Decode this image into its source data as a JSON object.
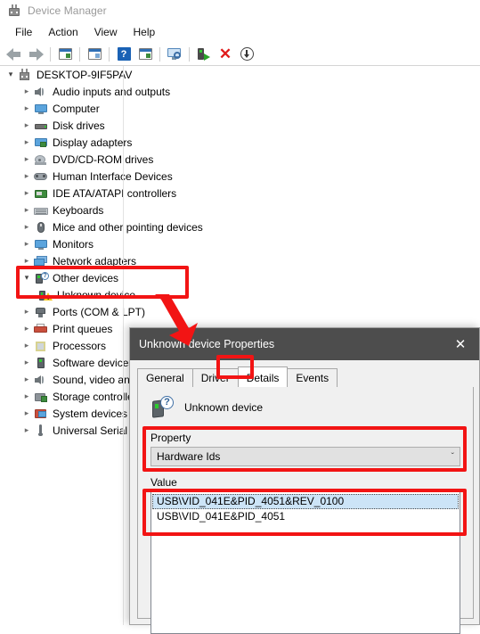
{
  "window": {
    "title": "Device Manager",
    "icon": "device-manager-icon"
  },
  "menubar": {
    "items": [
      {
        "label": "File"
      },
      {
        "label": "Action"
      },
      {
        "label": "View"
      },
      {
        "label": "Help"
      }
    ]
  },
  "toolbar": {
    "buttons": [
      {
        "name": "back-button",
        "icon": "back-arrow-icon"
      },
      {
        "name": "forward-button",
        "icon": "forward-arrow-icon"
      },
      {
        "name": "show-hide-console-tree-button",
        "icon": "console-tree-icon"
      },
      {
        "name": "properties-button",
        "icon": "properties-window-icon"
      },
      {
        "name": "help-button",
        "icon": "help-question-icon"
      },
      {
        "name": "show-hide-action-pane-button",
        "icon": "action-pane-icon"
      },
      {
        "name": "scan-for-hardware-changes-button",
        "icon": "monitor-magnifier-icon"
      },
      {
        "name": "update-driver-button",
        "icon": "device-update-icon"
      },
      {
        "name": "uninstall-device-button",
        "icon": "red-x-icon"
      },
      {
        "name": "disable-device-button",
        "icon": "down-arrow-circle-icon"
      }
    ]
  },
  "tree": {
    "root": {
      "label": "DESKTOP-9IF5PAV",
      "icon": "computer-icon",
      "expanded": true
    },
    "items": [
      {
        "label": "Audio inputs and outputs",
        "icon": "speaker-icon",
        "expanded": false
      },
      {
        "label": "Computer",
        "icon": "monitor-icon",
        "expanded": false
      },
      {
        "label": "Disk drives",
        "icon": "harddisk-icon",
        "expanded": false
      },
      {
        "label": "Display adapters",
        "icon": "display-adapter-icon",
        "expanded": false
      },
      {
        "label": "DVD/CD-ROM drives",
        "icon": "optical-drive-icon",
        "expanded": false
      },
      {
        "label": "Human Interface Devices",
        "icon": "gamepad-icon",
        "expanded": false
      },
      {
        "label": "IDE ATA/ATAPI controllers",
        "icon": "ide-controller-icon",
        "expanded": false
      },
      {
        "label": "Keyboards",
        "icon": "keyboard-icon",
        "expanded": false
      },
      {
        "label": "Mice and other pointing devices",
        "icon": "mouse-icon",
        "expanded": false
      },
      {
        "label": "Monitors",
        "icon": "monitor-icon",
        "expanded": false
      },
      {
        "label": "Network adapters",
        "icon": "network-adapter-icon",
        "expanded": false
      },
      {
        "label": "Other devices",
        "icon": "other-devices-icon",
        "expanded": true
      },
      {
        "label": "Unknown device",
        "icon": "unknown-device-warning-icon",
        "child": true
      },
      {
        "label": "Ports (COM & LPT)",
        "icon": "port-icon",
        "expanded": false
      },
      {
        "label": "Print queues",
        "icon": "printer-icon",
        "expanded": false
      },
      {
        "label": "Processors",
        "icon": "cpu-icon",
        "expanded": false
      },
      {
        "label": "Software devices",
        "icon": "software-device-icon",
        "expanded": false
      },
      {
        "label": "Sound, video and game controllers",
        "icon": "speaker-icon",
        "expanded": false
      },
      {
        "label": "Storage controllers",
        "icon": "storage-controller-icon",
        "expanded": false
      },
      {
        "label": "System devices",
        "icon": "system-device-icon",
        "expanded": false
      },
      {
        "label": "Universal Serial Bus controllers",
        "icon": "usb-icon",
        "expanded": false
      }
    ]
  },
  "dialog": {
    "title": "Unknown device Properties",
    "close_label": "✕",
    "tabs": [
      {
        "label": "General",
        "active": false
      },
      {
        "label": "Driver",
        "active": false
      },
      {
        "label": "Details",
        "active": true
      },
      {
        "label": "Events",
        "active": false
      }
    ],
    "device_name": "Unknown device",
    "device_icon": "unknown-device-question-icon",
    "property": {
      "label": "Property",
      "selected": "Hardware Ids",
      "chevron": "ˇ"
    },
    "value": {
      "label": "Value",
      "items": [
        {
          "text": "USB\\VID_041E&PID_4051&REV_0100",
          "selected": true
        },
        {
          "text": "USB\\VID_041E&PID_4051",
          "selected": false
        }
      ]
    }
  },
  "annotations": {
    "color": "#f21414",
    "boxes": [
      {
        "name": "highlight-other-devices"
      },
      {
        "name": "highlight-details-tab"
      },
      {
        "name": "highlight-property-dropdown"
      },
      {
        "name": "highlight-value-list"
      }
    ],
    "arrow": {
      "name": "pointer-arrow",
      "direction": "down"
    }
  }
}
